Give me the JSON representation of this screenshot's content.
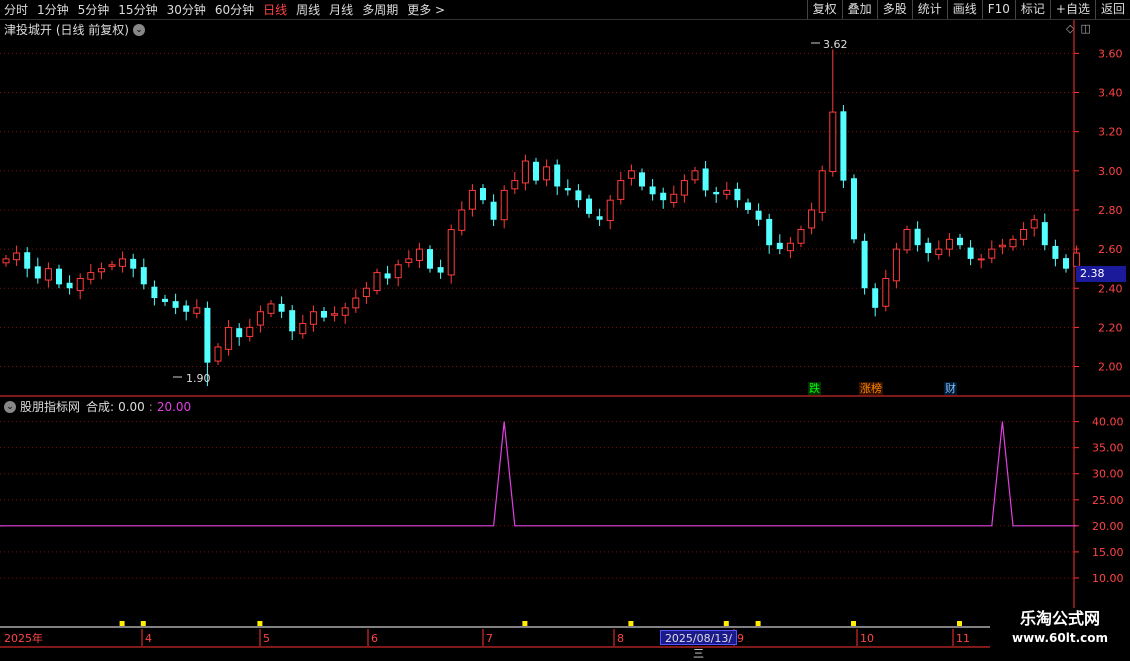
{
  "toolbar": {
    "periods": [
      "分时",
      "1分钟",
      "5分钟",
      "15分钟",
      "30分钟",
      "60分钟",
      "日线",
      "周线",
      "月线",
      "多周期",
      "更多 >"
    ],
    "active_period": "日线",
    "buttons": [
      "复权",
      "叠加",
      "多股",
      "统计",
      "画线",
      "F10",
      "标记",
      "+自选",
      "返回"
    ]
  },
  "stock": {
    "title": "津投城开 (日线 前复权)"
  },
  "price_axis": {
    "ticks": [
      "3.60",
      "3.40",
      "3.20",
      "3.00",
      "2.80",
      "2.60",
      "2.40",
      "2.20",
      "2.00"
    ]
  },
  "current_price": "2.38",
  "annotations": {
    "high_label": "3.62",
    "low_label": "1.90"
  },
  "events": {
    "e1": "跌",
    "e2": "涨榜",
    "e3": "财"
  },
  "indicator": {
    "name": "股朋指标网",
    "label": "合成:",
    "value1": "0.00",
    "value2": "20.00",
    "ticks": [
      "40.00",
      "35.00",
      "30.00",
      "25.00",
      "20.00",
      "15.00",
      "10.00"
    ]
  },
  "time_axis": {
    "labels": [
      "2025年",
      "4",
      "5",
      "6",
      "7",
      "8",
      "9",
      "10",
      "11"
    ],
    "cursor_date": "2025/08/13/三"
  },
  "watermark": {
    "title": "乐淘公式网",
    "url": "www.60lt.com"
  },
  "colors": {
    "up": "#ff3b3b",
    "down": "#54ffff",
    "indicator": "#e040e0",
    "axis": "#ff3333"
  },
  "chart_data": {
    "type": "candlestick",
    "ylim": [
      1.87,
      3.75
    ],
    "high": 3.62,
    "low": 1.9,
    "close_series": [
      2.55,
      2.58,
      2.5,
      2.45,
      2.5,
      2.42,
      2.4,
      2.45,
      2.48,
      2.5,
      2.52,
      2.55,
      2.5,
      2.42,
      2.35,
      2.33,
      2.3,
      2.28,
      2.3,
      2.02,
      2.1,
      2.2,
      2.15,
      2.2,
      2.28,
      2.32,
      2.28,
      2.18,
      2.22,
      2.28,
      2.25,
      2.27,
      2.3,
      2.35,
      2.4,
      2.48,
      2.45,
      2.52,
      2.55,
      2.6,
      2.5,
      2.48,
      2.7,
      2.8,
      2.9,
      2.85,
      2.75,
      2.9,
      2.95,
      3.05,
      2.95,
      3.02,
      2.92,
      2.9,
      2.85,
      2.78,
      2.75,
      2.85,
      2.95,
      3.0,
      2.92,
      2.88,
      2.85,
      2.88,
      2.95,
      3.0,
      2.9,
      2.88,
      2.9,
      2.85,
      2.8,
      2.75,
      2.62,
      2.6,
      2.63,
      2.7,
      2.8,
      3.0,
      3.3,
      2.95,
      2.65,
      2.4,
      2.3,
      2.45,
      2.6,
      2.7,
      2.62,
      2.58,
      2.6,
      2.65,
      2.62,
      2.55,
      2.55,
      2.6,
      2.62,
      2.65,
      2.7,
      2.75,
      2.62,
      2.55,
      2.5,
      2.58
    ]
  },
  "indicator_data": {
    "type": "line",
    "ylim": [
      5,
      43
    ],
    "baseline": 20,
    "spikes": [
      {
        "index": 47,
        "value": 40
      },
      {
        "index": 94,
        "value": 40
      }
    ]
  }
}
